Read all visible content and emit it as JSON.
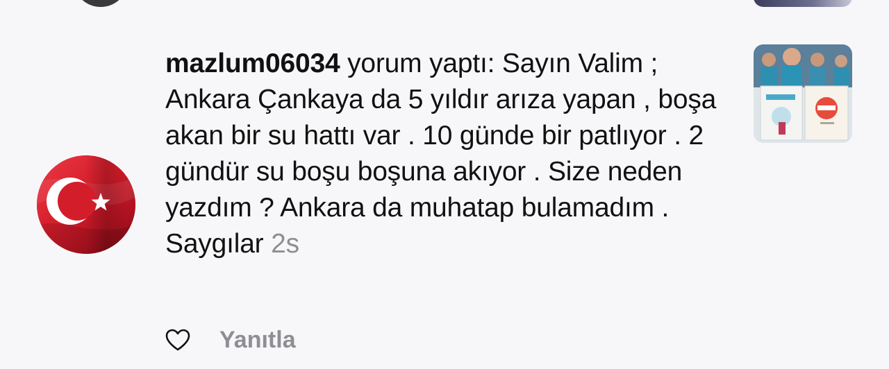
{
  "notification": {
    "username": "mazlum06034",
    "action": " yorum yaptı: ",
    "comment_text": "Sayın Valim ; Ankara Çankaya da 5 yıldır arıza yapan , boşa akan bir su hattı var . 10 günde bir patlıyor . 2 gündür su boşu boşuna akıyor . Size neden yazdım ? Ankara da muhatap bulamadım . Saygılar",
    "time": "2s",
    "reply_label": "Yanıtla",
    "avatar_icon": "turkish-flag-avatar",
    "like_icon": "heart-outline-icon",
    "thumbnail_icon": "post-thumbnail"
  },
  "colors": {
    "background": "#f7f7f9",
    "text": "#111111",
    "muted": "#8e8e93",
    "flag_red": "#d81e2c"
  }
}
